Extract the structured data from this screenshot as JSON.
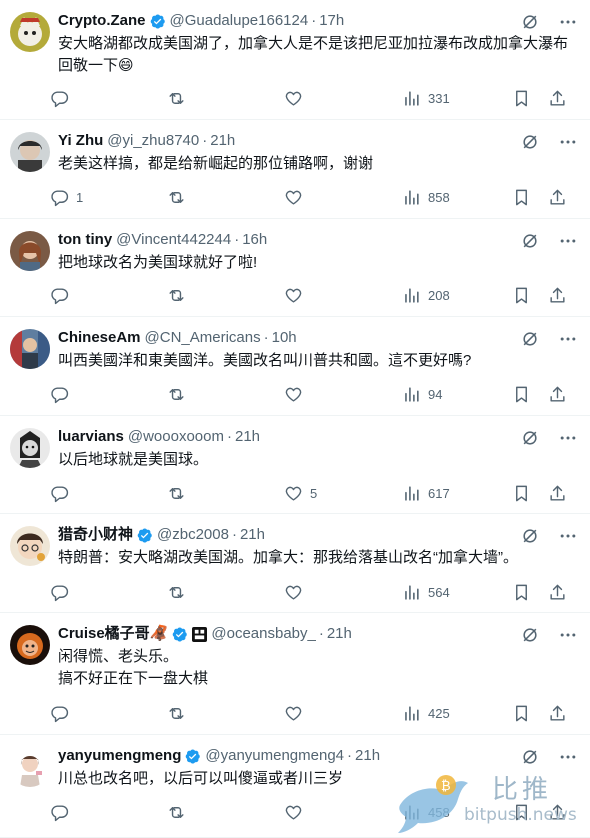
{
  "colors": {
    "verified_blue": "#1d9bf0",
    "gold_badge": "#e2b719",
    "text": "#0f1419",
    "muted": "#536471"
  },
  "tweets": [
    {
      "name": "Crypto.Zane",
      "verified": true,
      "handle": "@Guadalupe166124",
      "time": "17h",
      "lines": [
        "安大略湖都改成美国湖了，加拿大人是不是该把尼亚加拉瀑布改成加拿大瀑布",
        "回敬一下😄"
      ],
      "replies": "",
      "retweets": "",
      "likes": "",
      "views": "331"
    },
    {
      "name": "Yi Zhu",
      "verified": false,
      "handle": "@yi_zhu8740",
      "time": "21h",
      "lines": [
        "老美这样搞，都是给新崛起的那位铺路啊，谢谢"
      ],
      "replies": "1",
      "retweets": "",
      "likes": "",
      "views": "858"
    },
    {
      "name": "ton tiny",
      "verified": false,
      "handle": "@Vincent442244",
      "time": "16h",
      "lines": [
        "把地球改名为美国球就好了啦!"
      ],
      "replies": "",
      "retweets": "",
      "likes": "",
      "views": "208"
    },
    {
      "name": "ChineseAm",
      "verified": false,
      "handle": "@CN_Americans",
      "time": "10h",
      "lines": [
        "叫西美國洋和東美國洋。美國改名叫川普共和國。這不更好嗎?"
      ],
      "replies": "",
      "retweets": "",
      "likes": "",
      "views": "94"
    },
    {
      "name": "luarvians",
      "verified": false,
      "handle": "@woooxooom",
      "time": "21h",
      "lines": [
        "以后地球就是美国球。"
      ],
      "replies": "",
      "retweets": "",
      "likes": "5",
      "views": "617"
    },
    {
      "name": "猎奇小财神",
      "verified": true,
      "handle": "@zbc2008",
      "time": "21h",
      "lines": [
        "特朗普：安大略湖改美国湖。加拿大：那我给落基山改名“加拿大墙”。"
      ],
      "replies": "",
      "retweets": "",
      "likes": "",
      "views": "564"
    },
    {
      "name": "Cruise橘子哥🦧",
      "verified": true,
      "extra_badge": true,
      "handle": "@oceansbaby_",
      "time": "21h",
      "lines": [
        "闲得慌、老头乐。",
        "搞不好正在下一盘大棋"
      ],
      "replies": "",
      "retweets": "",
      "likes": "",
      "views": "425"
    },
    {
      "name": "yanyumengmeng",
      "verified": true,
      "handle": "@yanyumengmeng4",
      "time": "21h",
      "lines": [
        "川总也改名吧，以后可以叫傻逼或者川三岁"
      ],
      "replies": "",
      "retweets": "",
      "likes": "",
      "views": "458"
    }
  ],
  "watermark": {
    "brand": "比推",
    "url": "bitpush.news"
  }
}
